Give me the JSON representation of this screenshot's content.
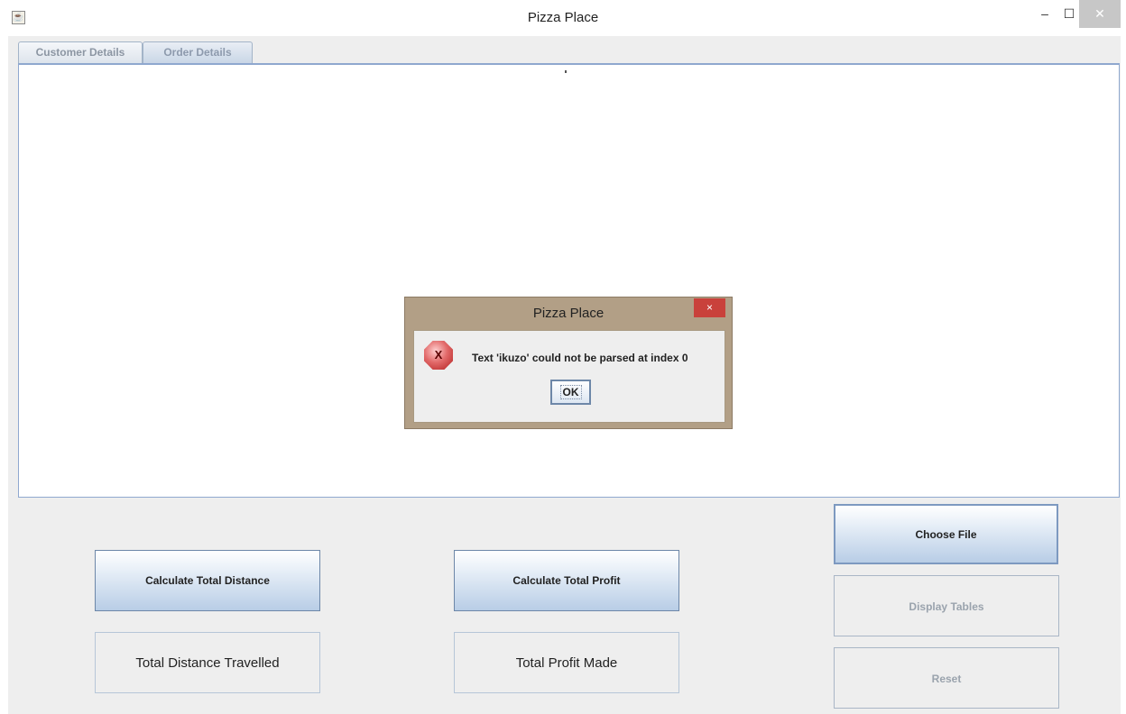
{
  "window": {
    "title": "Pizza Place",
    "icon": "java-cup-icon",
    "minimize": "‒",
    "maximize": "☐",
    "close": "✕"
  },
  "tabs": [
    {
      "label": "Customer Details",
      "selected": false
    },
    {
      "label": "Order Details",
      "selected": true
    }
  ],
  "buttons": {
    "calc_distance": "Calculate Total Distance",
    "calc_profit": "Calculate Total Profit",
    "choose_file": "Choose File",
    "display_tables": "Display Tables",
    "reset": "Reset"
  },
  "fields": {
    "total_distance": "Total Distance Travelled",
    "total_profit": "Total Profit Made"
  },
  "dialog": {
    "title": "Pizza Place",
    "close": "×",
    "icon": "error-icon",
    "message": "Text 'ikuzo' could not be parsed at index 0",
    "ok": "OK"
  },
  "colors": {
    "accent": "#b8cde6",
    "dialog_frame": "#b29f86",
    "close_red": "#c9413b"
  }
}
